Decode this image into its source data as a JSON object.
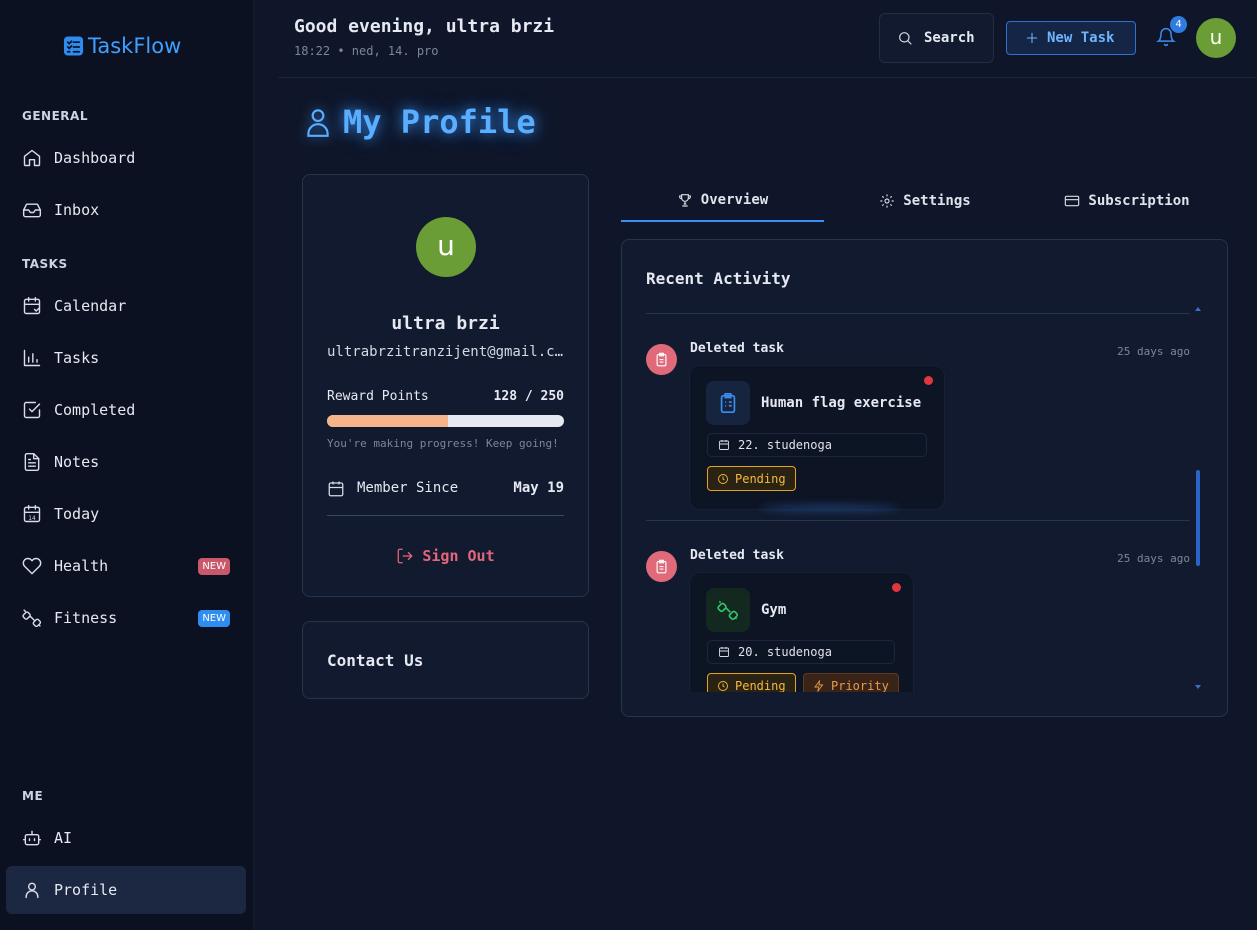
{
  "app": {
    "name": "TaskFlow"
  },
  "sidebar": {
    "sections": {
      "general": "GENERAL",
      "tasks": "TASKS",
      "me": "ME"
    },
    "items": [
      {
        "label": "Dashboard",
        "icon": "home-icon"
      },
      {
        "label": "Inbox",
        "icon": "inbox-icon"
      },
      {
        "label": "Calendar",
        "icon": "calendar-icon"
      },
      {
        "label": "Tasks",
        "icon": "bar-chart-icon"
      },
      {
        "label": "Completed",
        "icon": "check-square-icon"
      },
      {
        "label": "Notes",
        "icon": "file-text-icon"
      },
      {
        "label": "Today",
        "icon": "calendar-day-icon",
        "day": "14"
      },
      {
        "label": "Health",
        "icon": "heart-icon",
        "badge": "NEW",
        "badge_color": "#c9586a"
      },
      {
        "label": "Fitness",
        "icon": "dumbbell-icon",
        "badge": "NEW",
        "badge_color": "#2f8cf0"
      },
      {
        "label": "AI",
        "icon": "bot-icon"
      },
      {
        "label": "Profile",
        "icon": "user-icon",
        "active": true
      }
    ]
  },
  "header": {
    "greeting": "Good evening, ultra brzi",
    "datetime": "18:22 • ned, 14. pro",
    "search_label": "Search",
    "new_task_label": "New Task",
    "notifications_count": "4",
    "avatar_letter": "u"
  },
  "page": {
    "title": "My Profile"
  },
  "profile": {
    "avatar_letter": "u",
    "name": "ultra brzi",
    "email": "ultrabrzitranzijent@gmail.com",
    "reward_label": "Reward Points",
    "reward_value": "128 / 250",
    "reward_fraction": 0.512,
    "progress_message": "You're making progress! Keep going!",
    "member_label": "Member Since",
    "member_value": "May 19",
    "sign_out_label": "Sign Out"
  },
  "contact": {
    "title": "Contact Us"
  },
  "tabs": [
    {
      "label": "Overview",
      "icon": "trophy-icon",
      "active": true
    },
    {
      "label": "Settings",
      "icon": "gear-icon"
    },
    {
      "label": "Subscription",
      "icon": "credit-card-icon"
    }
  ],
  "activity": {
    "title": "Recent Activity",
    "items": [
      {
        "action": "Deleted task",
        "time": "25 days ago",
        "task": {
          "name": "Human flag exercise",
          "date": "22. studenoga",
          "icon": "clipboard-icon",
          "tags": [
            "Pending"
          ]
        }
      },
      {
        "action": "Deleted task",
        "time": "25 days ago",
        "task": {
          "name": "Gym",
          "date": "20. studenoga",
          "icon": "dumbbell-icon",
          "tags": [
            "Pending",
            "Priority"
          ]
        }
      }
    ]
  },
  "colors": {
    "accent": "#3a8ff0",
    "avatar": "#6a9d36",
    "danger": "#e5667a",
    "pending": "#f4bb3c"
  }
}
